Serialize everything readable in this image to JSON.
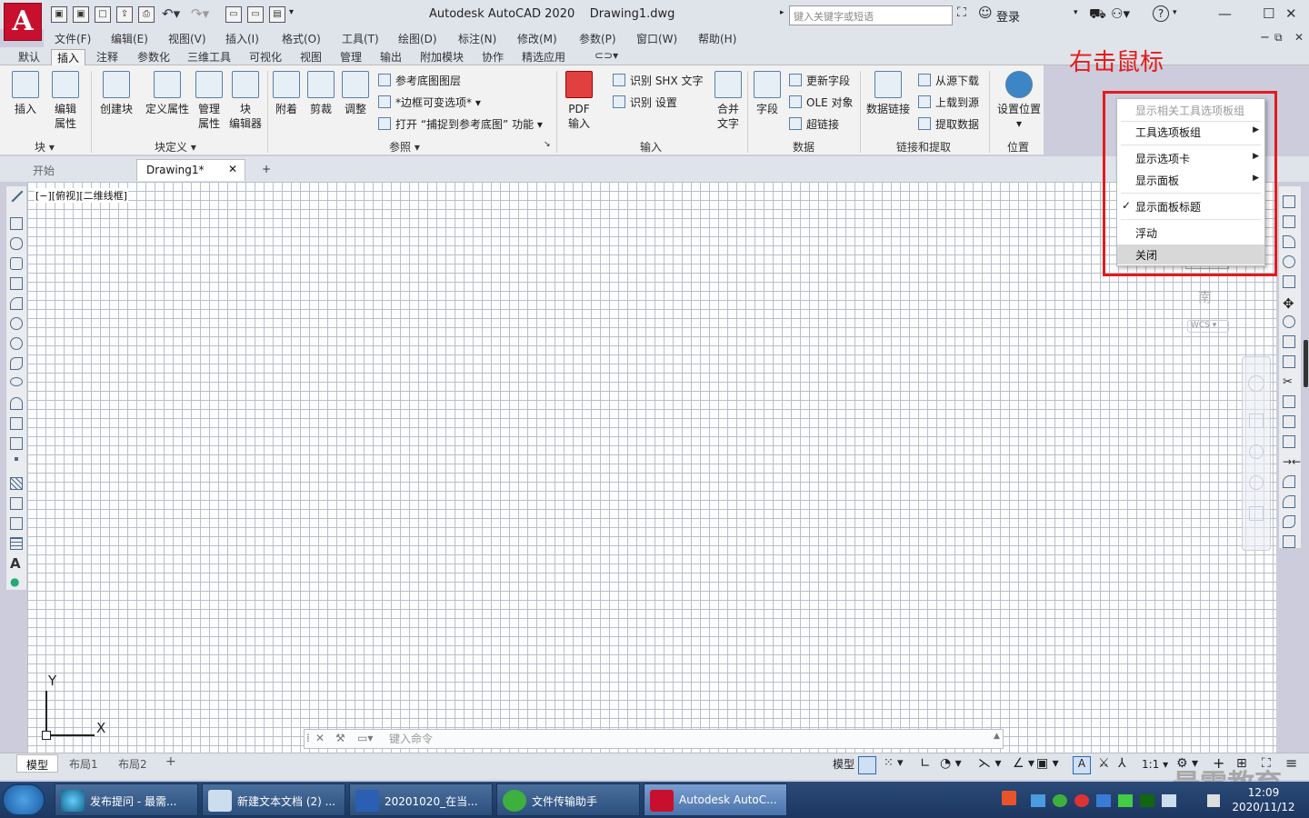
{
  "app": {
    "logo": "A",
    "title": "Autodesk AutoCAD 2020",
    "drawing": "Drawing1.dwg",
    "search_placeholder": "键入关键字或短语",
    "signin": "登录",
    "help": "?"
  },
  "quick_access": [
    "save-icon",
    "save-as-icon",
    "new-icon",
    "plot-icon",
    "undo-icon",
    "redo-icon",
    "open-icon",
    "new-file-icon",
    "publish-icon"
  ],
  "menus": [
    "文件(F)",
    "编辑(E)",
    "视图(V)",
    "插入(I)",
    "格式(O)",
    "工具(T)",
    "绘图(D)",
    "标注(N)",
    "修改(M)",
    "参数(P)",
    "窗口(W)",
    "帮助(H)"
  ],
  "ribbon_tabs": [
    "默认",
    "插入",
    "注释",
    "参数化",
    "三维工具",
    "可视化",
    "视图",
    "管理",
    "输出",
    "附加模块",
    "协作",
    "精选应用"
  ],
  "ribbon_active_tab": "插入",
  "ribbon": {
    "block": {
      "title": "块",
      "buttons": [
        "插入",
        "编辑\n属性"
      ]
    },
    "block_def": {
      "title": "块定义",
      "buttons": [
        "创建块",
        "定义属性",
        "管理\n属性",
        "块\n编辑器"
      ]
    },
    "reference": {
      "title": "参照",
      "buttons": [
        "附着",
        "剪裁",
        "调整"
      ],
      "small": [
        "参考底图图层",
        "*边框可变选项*",
        "打开 “捕捉到参考底图” 功能"
      ]
    },
    "import": {
      "title": "输入",
      "pdf": "PDF\n输入",
      "small": [
        "识别 SHX 文字",
        "识别 设置"
      ],
      "merge": "合并\n文字"
    },
    "data": {
      "title": "数据",
      "field": "字段",
      "small": [
        "更新字段",
        "OLE 对象",
        "超链接"
      ]
    },
    "link": {
      "title": "链接和提取",
      "data_link": "数据链接",
      "small": [
        "从源下载",
        "上载到源",
        "提取数据"
      ]
    },
    "location": {
      "title": "位置",
      "button": "设置位置"
    }
  },
  "doc_tabs": {
    "start": "开始",
    "drawing": "Drawing1*"
  },
  "viewport_label": "[−][俯视][二维线框]",
  "annotation": "右击鼠标",
  "context_menu": [
    {
      "label": "显示相关工具选项板组",
      "disabled": true
    },
    {
      "label": "工具选项板组",
      "submenu": true
    },
    {
      "label": "显示选项卡",
      "submenu": true
    },
    {
      "label": "显示面板",
      "submenu": true
    },
    {
      "label": "显示面板标题",
      "checked": true
    },
    {
      "label": "浮动"
    },
    {
      "label": "关闭",
      "hover": true
    }
  ],
  "viewcube": {
    "south": "南",
    "wcs": "WCS"
  },
  "ucs": {
    "x": "X",
    "y": "Y"
  },
  "command_placeholder": "键入命令",
  "layout_tabs": [
    "模型",
    "布局1",
    "布局2"
  ],
  "status": {
    "model": "模型",
    "scale": "1:1"
  },
  "taskbar": {
    "tasks": [
      "发布提问 - 最需...",
      "新建文本文档 (2) ...",
      "20201020_在当...",
      "文件传输助手",
      "Autodesk AutoC..."
    ],
    "time": "12:09",
    "date": "2020/11/12"
  },
  "watermark": "最需教育"
}
